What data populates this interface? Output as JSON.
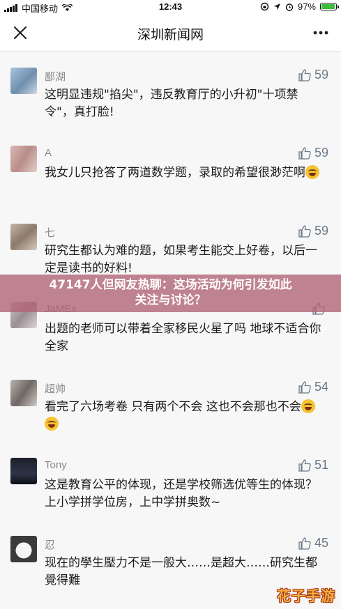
{
  "status_bar": {
    "carrier": "中国移动",
    "time": "12:43",
    "battery_percent": "97%",
    "battery_level": 0.97
  },
  "nav": {
    "title": "深圳新闻网",
    "close_icon": "close-icon",
    "more_icon": "more-dots-icon"
  },
  "comments": [
    {
      "username": "鄙湖",
      "likes": "59",
      "text": "这明显违规\"掐尖\"，违反教育厅的小升初\"十项禁令\"，真打脸!",
      "emojis": 0
    },
    {
      "username": "A",
      "likes": "59",
      "text": "我女儿只抢答了两道数学题，录取的希望很渺茫啊",
      "emojis": 1
    },
    {
      "username": "七",
      "likes": "59",
      "text": "研究生都认为难的题，如果考生能交上好卷，以后一定是读书的好料!",
      "emojis": 0
    },
    {
      "username": "JaMEs",
      "likes": "",
      "text": "出题的老师可以带着全家移民火星了吗 地球不适合你全家",
      "emojis": 0
    },
    {
      "username": "超帅",
      "likes": "54",
      "text": "看完了六场考卷 只有两个不会 这也不会那也不会",
      "emojis": 2
    },
    {
      "username": "Tony",
      "likes": "51",
      "text": "这是教育公平的体现，还是学校筛选优等生的体现？上小学拼学位房，上中学拼奥数~",
      "emojis": 0
    },
    {
      "username": "忍",
      "likes": "45",
      "text": "现在的學生壓力不是一般大……是超大……研究生都覺得難",
      "emojis": 0
    }
  ],
  "banner": {
    "line1": "47147人但网友热聊：这场活动为何引发如此",
    "line2": "关注与讨论？"
  },
  "watermark": "花子手游",
  "colors": {
    "banner_bg": "#b06273",
    "like_color": "#6b7a8a",
    "watermark": "#f2b23e"
  }
}
